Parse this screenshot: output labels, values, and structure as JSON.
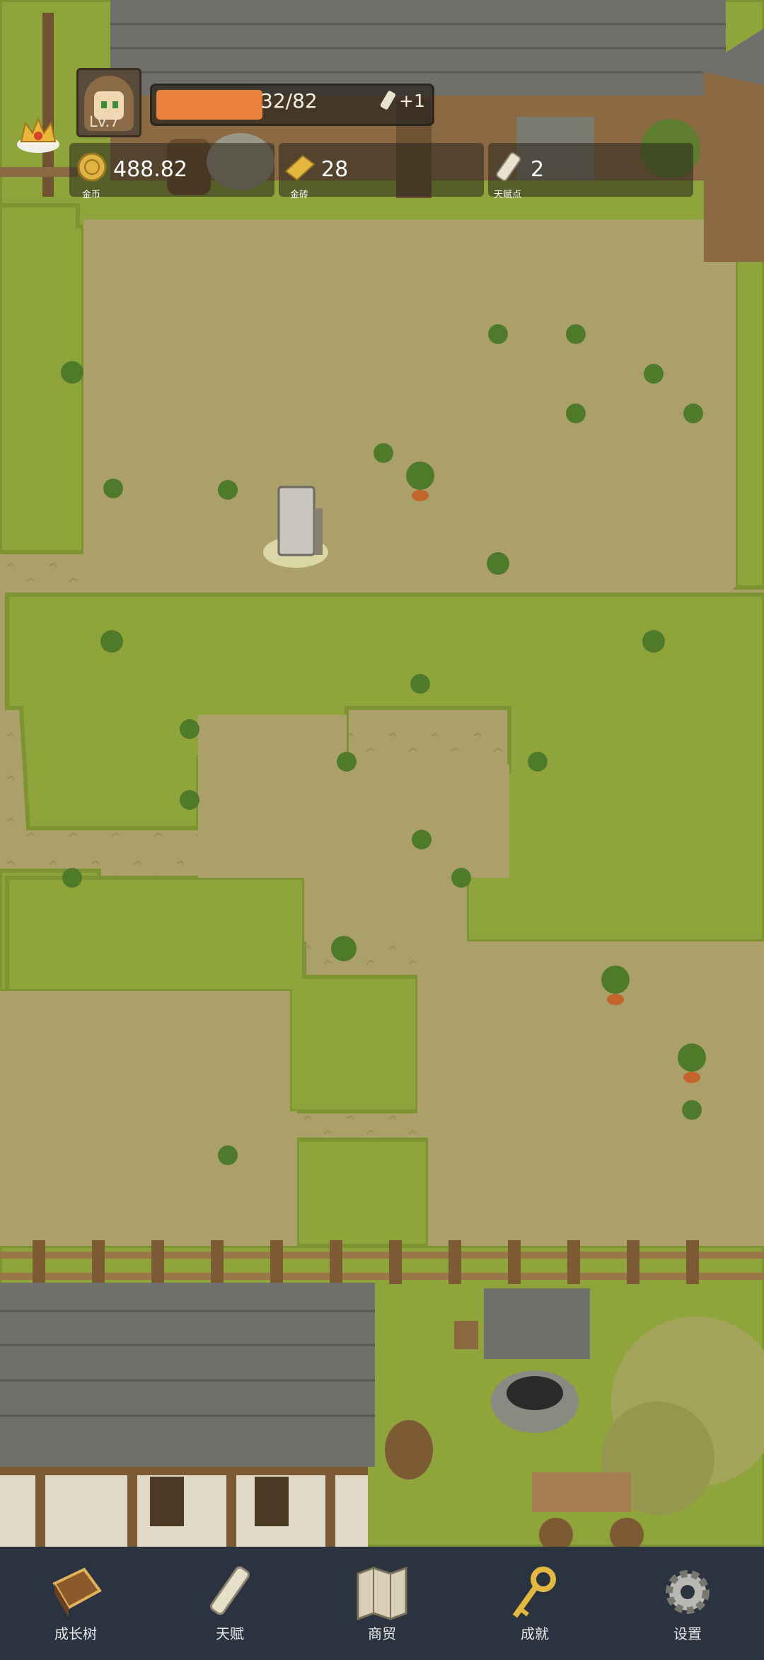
{
  "player": {
    "level": "Lv.7",
    "xp_text": "32/82",
    "xp_progress": 0.39,
    "xp_bonus": "+1"
  },
  "resources": {
    "gold": {
      "value": "488.82",
      "label": "金币"
    },
    "gold_bar": {
      "value": "28",
      "label": "金砖"
    },
    "talent_points": {
      "value": "2",
      "label": "天赋点"
    }
  },
  "nav": {
    "tabs": [
      {
        "label": "成长树",
        "icon": "book-icon"
      },
      {
        "label": "天赋",
        "icon": "scroll-icon"
      },
      {
        "label": "商贸",
        "icon": "map-icon"
      },
      {
        "label": "成就",
        "icon": "key-icon"
      },
      {
        "label": "设置",
        "icon": "gear-icon"
      }
    ]
  },
  "colors": {
    "xp_fill": "#e8823b",
    "tab_bar": "#2b3240",
    "dirt": "#a99f68",
    "grass": "#8ea63d"
  }
}
